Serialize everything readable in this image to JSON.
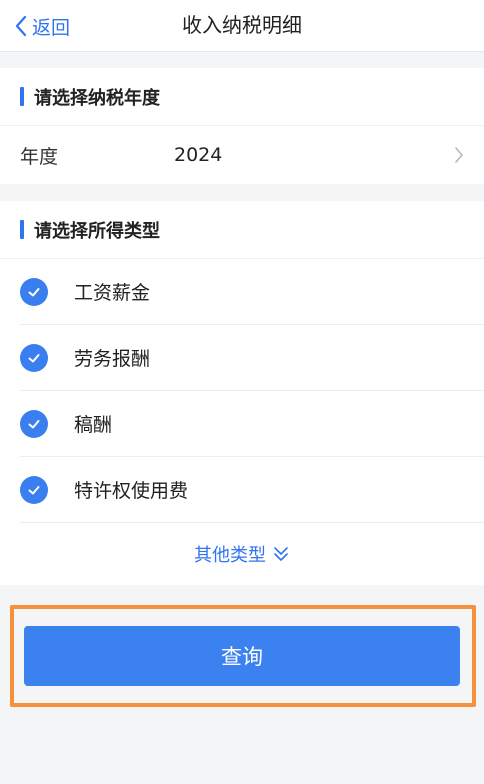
{
  "nav": {
    "back_label": "返回",
    "title": "收入纳税明细"
  },
  "year_section": {
    "title": "请选择纳税年度",
    "row_label": "年度",
    "row_value": "2024"
  },
  "type_section": {
    "title": "请选择所得类型",
    "items": [
      {
        "label": "工资薪金",
        "checked": true
      },
      {
        "label": "劳务报酬",
        "checked": true
      },
      {
        "label": "稿酬",
        "checked": true
      },
      {
        "label": "特许权使用费",
        "checked": true
      }
    ],
    "more_label": "其他类型"
  },
  "query_button": {
    "label": "查询"
  },
  "colors": {
    "accent": "#2f74f0",
    "highlight": "#f7903a"
  }
}
